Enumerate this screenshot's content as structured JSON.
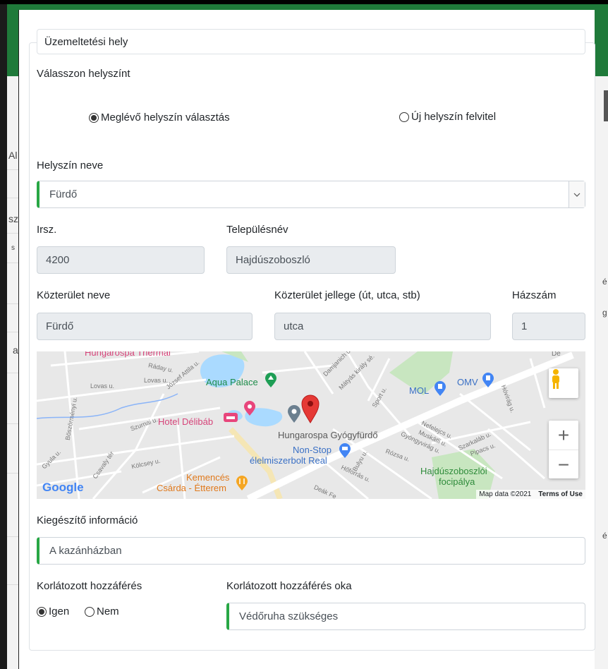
{
  "background": {
    "fragments": [
      "Al",
      "sz",
      "s",
      "a",
      "é",
      "g",
      "é"
    ]
  },
  "fieldset": {
    "legend": "Üzemeltetési hely"
  },
  "location_choice": {
    "label": "Válasszon helyszínt",
    "options": [
      {
        "label": "Meglévő helyszín választás",
        "selected": true
      },
      {
        "label": "Új helyszín felvitel",
        "selected": false
      }
    ]
  },
  "site_name": {
    "label": "Helyszín neve",
    "value": "Fürdő"
  },
  "zip": {
    "label": "Irsz.",
    "value": "4200"
  },
  "city": {
    "label": "Településnév",
    "value": "Hajdúszoboszló"
  },
  "street_name": {
    "label": "Közterület neve",
    "value": "Fürdő"
  },
  "street_type": {
    "label": "Közterület jellege (út, utca, stb)",
    "value": "utca"
  },
  "house_no": {
    "label": "Házszám",
    "value": "1"
  },
  "map": {
    "labels": {
      "hungarospa_thermal": "Hungarospa Thermal",
      "aqua_palace": "Aqua Palace",
      "hotel_delibab": "Hotel Délibáb",
      "hungarospa_gyogyfurdo": "Hungarospa Gyógyfürdő",
      "nonstop_1": "Non-Stop",
      "nonstop_2": "élelmiszerbolt Real",
      "kemences_1": "Kemencés",
      "kemences_2": "Csárda - Étterem",
      "mol": "MOL",
      "omv": "OMV",
      "focipalya_1": "Hajdúszoboszlói",
      "focipalya_2": "focipálya",
      "lovas": "Lovas u.",
      "lovas2": "Lovas u.",
      "raday": "Ráday u.",
      "jozsef_attila": "József Attila u.",
      "bószormeny": "Böszörményi u.",
      "szurnai": "Szurnai u.",
      "csavaly": "Csavaly tér",
      "kolcsey": "Kölcsey u.",
      "gyula": "Gyula u.",
      "damjanich": "Damjanich u.",
      "matyas_kiraly": "Mátyás király sé.",
      "sport": "Sport u.",
      "nefelejcs": "Nefelejcs u.",
      "muskatli": "Muskátli u.",
      "gyongyviraq": "Gyöngyvirág u.",
      "rozsa": "Rózsa u.",
      "bulyu": "Bulyu u.",
      "hoforras": "Hőforrás u.",
      "szarkalab": "Szarkaláb u.",
      "pipacs": "Pipacs u.",
      "hovirag": "Hóvirág u.",
      "deak": "Deák Fe",
      "de": "De"
    },
    "google": "Google",
    "map_data": "Map data ©2021",
    "terms": "Terms of Use",
    "zoom_in": "+",
    "zoom_out": "−"
  },
  "extra_info": {
    "label": "Kiegészítő információ",
    "value": "A kazánházban"
  },
  "restricted": {
    "label": "Korlátozott hozzáférés",
    "options": [
      {
        "label": "Igen",
        "selected": true
      },
      {
        "label": "Nem",
        "selected": false
      }
    ]
  },
  "restricted_reason": {
    "label": "Korlátozott hozzáférés oka",
    "value": "Védőruha szükséges"
  },
  "colors": {
    "accent_valid": "#28a745",
    "header_green": "#1f7a3a",
    "readonly_bg": "#e9ecef"
  }
}
